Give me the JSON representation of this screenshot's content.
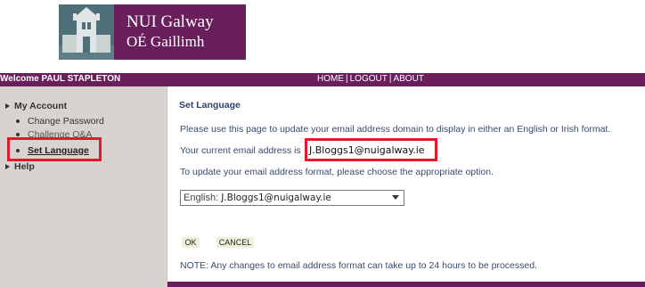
{
  "logo": {
    "line1": "NUI Galway",
    "line2": "OÉ Gaillimh"
  },
  "topbar": {
    "welcome": "Welcome PAUL STAPLETON",
    "nav": [
      "HOME",
      "LOGOUT",
      "ABOUT"
    ],
    "separator": "|"
  },
  "sidebar": {
    "my_account": "My Account",
    "items": [
      "Change Password",
      "Challenge Q&A",
      "Set Language"
    ],
    "help": "Help"
  },
  "main": {
    "title": "Set Language",
    "intro": "Please use this page to update your email address domain to display in either an English or Irish format.",
    "current_label": "Your current email address is",
    "current_email": "J.Bloggs1@nuigalway.ie",
    "instruction": "To update your email address format, please choose the appropriate option.",
    "select_prefix": "English:",
    "select_value": "J.Bloggs1@nuigalway.ie",
    "ok": "OK",
    "cancel": "CANCEL",
    "note": "NOTE: Any changes to email address format can take up to 24 hours to be processed."
  },
  "colors": {
    "brand_purple": "#6a1f5d",
    "sidebar_bg": "#d8d3ce",
    "highlight_red": "#e01a2a",
    "heading_blue": "#2f3f66"
  }
}
